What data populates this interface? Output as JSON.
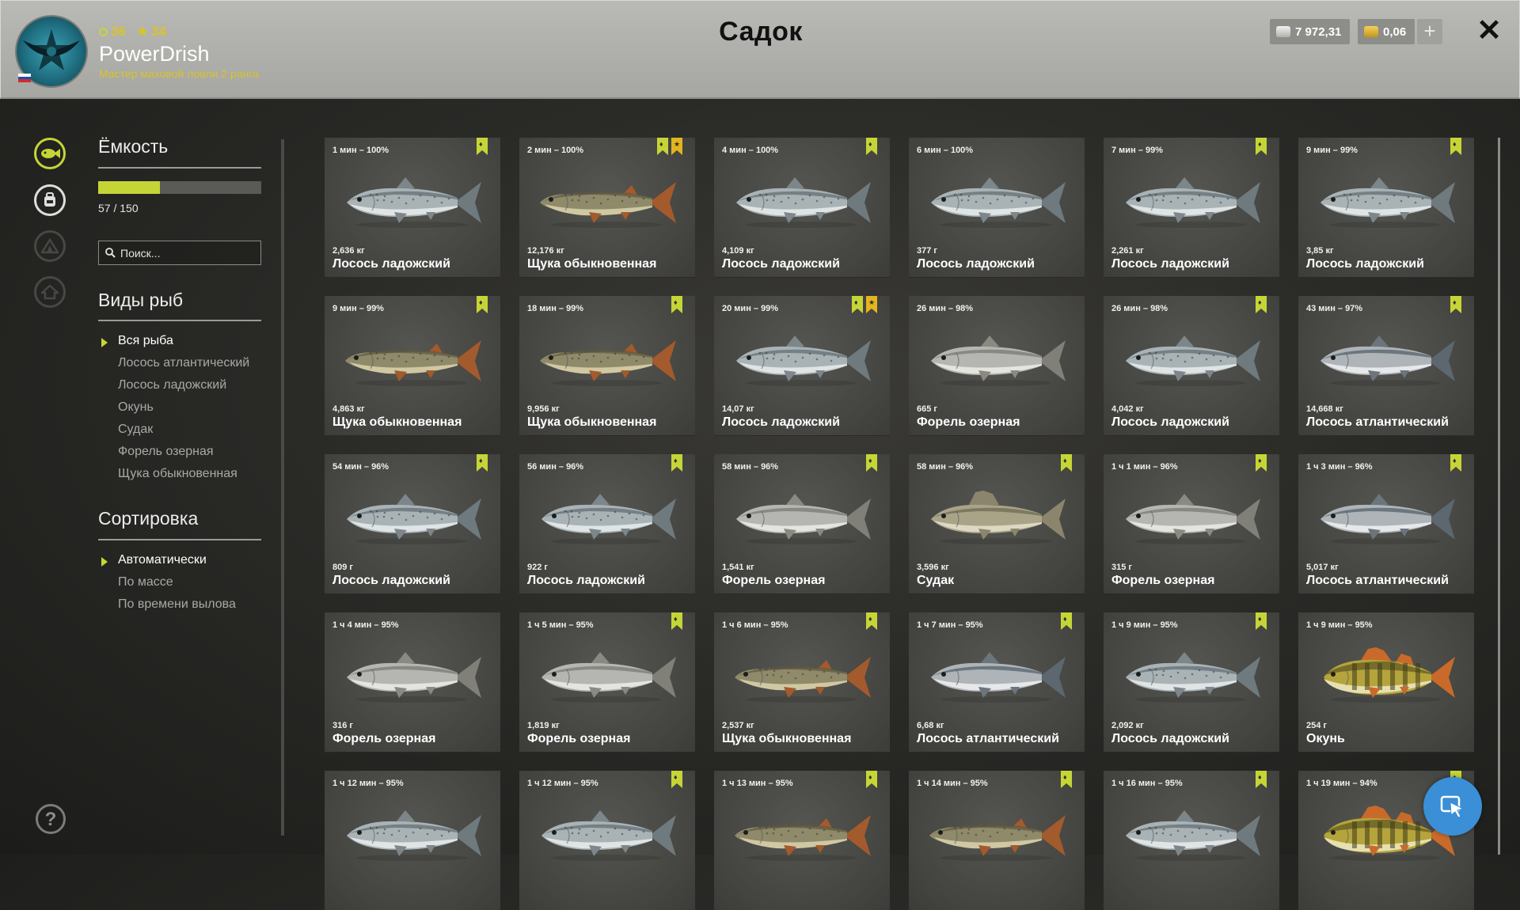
{
  "header": {
    "title": "Садок",
    "player": {
      "level": "36",
      "stars": "34",
      "name": "PowerDrish",
      "rank": "Мастер маховой ловли 2 ранга",
      "flag": "Russia"
    },
    "currency": {
      "silver": "7 972,31",
      "gold": "0,06",
      "add_icon": "plus-icon"
    },
    "close_icon": "close-icon"
  },
  "rail": {
    "items": [
      {
        "name": "fish-keepnet-icon",
        "active": true
      },
      {
        "name": "backpack-icon",
        "active": false
      },
      {
        "name": "tent-icon",
        "active": false
      },
      {
        "name": "home-icon",
        "active": false
      }
    ],
    "help": "?"
  },
  "filters": {
    "capacity": {
      "title": "Ёмкость",
      "value": 57,
      "max": 150,
      "label": "57 / 150"
    },
    "search": {
      "placeholder": "Поиск..."
    },
    "species": {
      "title": "Виды рыб",
      "options": [
        "Вся рыба",
        "Лосось атлантический",
        "Лосось ладожский",
        "Окунь",
        "Судак",
        "Форель озерная",
        "Щука обыкновенная"
      ],
      "selected": "Вся рыба"
    },
    "sort": {
      "title": "Сортировка",
      "options": [
        "Автоматически",
        "По массе",
        "По времени вылова"
      ],
      "selected": "Автоматически"
    }
  },
  "colors": {
    "accent": "#c6d536",
    "gold": "#d9c42a",
    "trophy_star": "#e3b51e",
    "header_bg": "#b0b0ac",
    "panel_bg": "#2d2d2a",
    "card_bg": "#4a4a47"
  },
  "cards": [
    {
      "time": "1 мин – 100%",
      "weight": "2,636 кг",
      "name": "Лосось ладожский",
      "species": "salmon",
      "marks": [
        "bookmark"
      ]
    },
    {
      "time": "2 мин – 100%",
      "weight": "12,176 кг",
      "name": "Щука обыкновенная",
      "species": "pike",
      "marks": [
        "bookmark",
        "star"
      ]
    },
    {
      "time": "4 мин – 100%",
      "weight": "4,109 кг",
      "name": "Лосось ладожский",
      "species": "salmon",
      "marks": [
        "bookmark"
      ]
    },
    {
      "time": "6 мин – 100%",
      "weight": "377 г",
      "name": "Лосось ладожский",
      "species": "salmon",
      "marks": []
    },
    {
      "time": "7 мин – 99%",
      "weight": "2,261 кг",
      "name": "Лосось ладожский",
      "species": "salmon",
      "marks": [
        "bookmark"
      ]
    },
    {
      "time": "9 мин – 99%",
      "weight": "3,85 кг",
      "name": "Лосось ладожский",
      "species": "salmon",
      "marks": [
        "bookmark"
      ]
    },
    {
      "time": "9 мин – 99%",
      "weight": "4,863 кг",
      "name": "Щука обыкновенная",
      "species": "pike",
      "marks": [
        "bookmark"
      ]
    },
    {
      "time": "18 мин – 99%",
      "weight": "9,956 кг",
      "name": "Щука обыкновенная",
      "species": "pike",
      "marks": [
        "bookmark"
      ]
    },
    {
      "time": "20 мин – 99%",
      "weight": "14,07 кг",
      "name": "Лосось ладожский",
      "species": "salmon",
      "marks": [
        "bookmark",
        "star"
      ]
    },
    {
      "time": "26 мин – 98%",
      "weight": "665 г",
      "name": "Форель озерная",
      "species": "trout",
      "marks": []
    },
    {
      "time": "26 мин – 98%",
      "weight": "4,042 кг",
      "name": "Лосось ладожский",
      "species": "salmon",
      "marks": [
        "bookmark"
      ]
    },
    {
      "time": "43 мин – 97%",
      "weight": "14,668 кг",
      "name": "Лосось атлантический",
      "species": "atlantic",
      "marks": [
        "bookmark"
      ]
    },
    {
      "time": "54 мин – 96%",
      "weight": "809 г",
      "name": "Лосось ладожский",
      "species": "salmon",
      "marks": [
        "bookmark"
      ]
    },
    {
      "time": "56 мин – 96%",
      "weight": "922 г",
      "name": "Лосось ладожский",
      "species": "salmon",
      "marks": [
        "bookmark"
      ]
    },
    {
      "time": "58 мин – 96%",
      "weight": "1,541 кг",
      "name": "Форель озерная",
      "species": "trout",
      "marks": [
        "bookmark"
      ]
    },
    {
      "time": "58 мин – 96%",
      "weight": "3,596 кг",
      "name": "Судак",
      "species": "zander",
      "marks": [
        "bookmark"
      ]
    },
    {
      "time": "1 ч 1 мин – 96%",
      "weight": "315 г",
      "name": "Форель озерная",
      "species": "trout",
      "marks": [
        "bookmark"
      ]
    },
    {
      "time": "1 ч 3 мин – 96%",
      "weight": "5,017 кг",
      "name": "Лосось атлантический",
      "species": "atlantic",
      "marks": [
        "bookmark"
      ]
    },
    {
      "time": "1 ч 4 мин – 95%",
      "weight": "316 г",
      "name": "Форель озерная",
      "species": "trout",
      "marks": []
    },
    {
      "time": "1 ч 5 мин – 95%",
      "weight": "1,819 кг",
      "name": "Форель озерная",
      "species": "trout",
      "marks": [
        "bookmark"
      ]
    },
    {
      "time": "1 ч 6 мин – 95%",
      "weight": "2,537 кг",
      "name": "Щука обыкновенная",
      "species": "pike",
      "marks": [
        "bookmark"
      ]
    },
    {
      "time": "1 ч 7 мин – 95%",
      "weight": "6,68 кг",
      "name": "Лосось атлантический",
      "species": "atlantic",
      "marks": [
        "bookmark"
      ]
    },
    {
      "time": "1 ч 9 мин – 95%",
      "weight": "2,092 кг",
      "name": "Лосось ладожский",
      "species": "salmon",
      "marks": [
        "bookmark"
      ]
    },
    {
      "time": "1 ч 9 мин – 95%",
      "weight": "254 г",
      "name": "Окунь",
      "species": "perch",
      "marks": []
    },
    {
      "time": "1 ч 12 мин – 95%",
      "weight": "",
      "name": "",
      "species": "salmon",
      "marks": []
    },
    {
      "time": "1 ч 12 мин – 95%",
      "weight": "",
      "name": "",
      "species": "salmon",
      "marks": [
        "bookmark"
      ]
    },
    {
      "time": "1 ч 13 мин – 95%",
      "weight": "",
      "name": "",
      "species": "pike",
      "marks": [
        "bookmark"
      ]
    },
    {
      "time": "1 ч 14 мин – 95%",
      "weight": "",
      "name": "",
      "species": "pike",
      "marks": [
        "bookmark"
      ]
    },
    {
      "time": "1 ч 16 мин – 95%",
      "weight": "",
      "name": "",
      "species": "salmon",
      "marks": [
        "bookmark"
      ]
    },
    {
      "time": "1 ч 19 мин – 94%",
      "weight": "",
      "name": "",
      "species": "perch",
      "marks": [
        "bookmark"
      ]
    }
  ],
  "floating_button": {
    "icon": "cursor-icon"
  }
}
